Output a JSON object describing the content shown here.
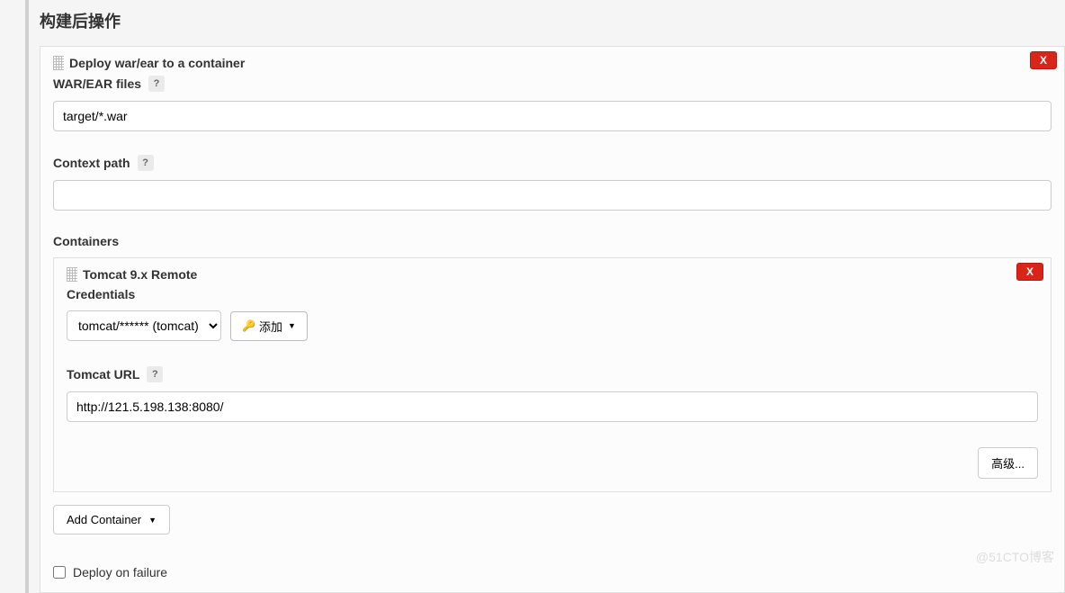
{
  "section_title": "构建后操作",
  "step": {
    "title": "Deploy war/ear to a container",
    "delete_label": "X",
    "fields": {
      "war_ear_label": "WAR/EAR files",
      "war_ear_value": "target/*.war",
      "context_path_label": "Context path",
      "context_path_value": "",
      "containers_label": "Containers"
    },
    "container": {
      "title": "Tomcat 9.x Remote",
      "delete_label": "X",
      "credentials_label": "Credentials",
      "credentials_selected": "tomcat/****** (tomcat)",
      "add_cred_label": "添加",
      "tomcat_url_label": "Tomcat URL",
      "tomcat_url_value": "http://121.5.198.138:8080/",
      "advanced_label": "高级..."
    },
    "add_container_label": "Add Container",
    "deploy_on_failure_label": "Deploy on failure",
    "deploy_on_failure_checked": false
  },
  "watermark": "@51CTO博客"
}
